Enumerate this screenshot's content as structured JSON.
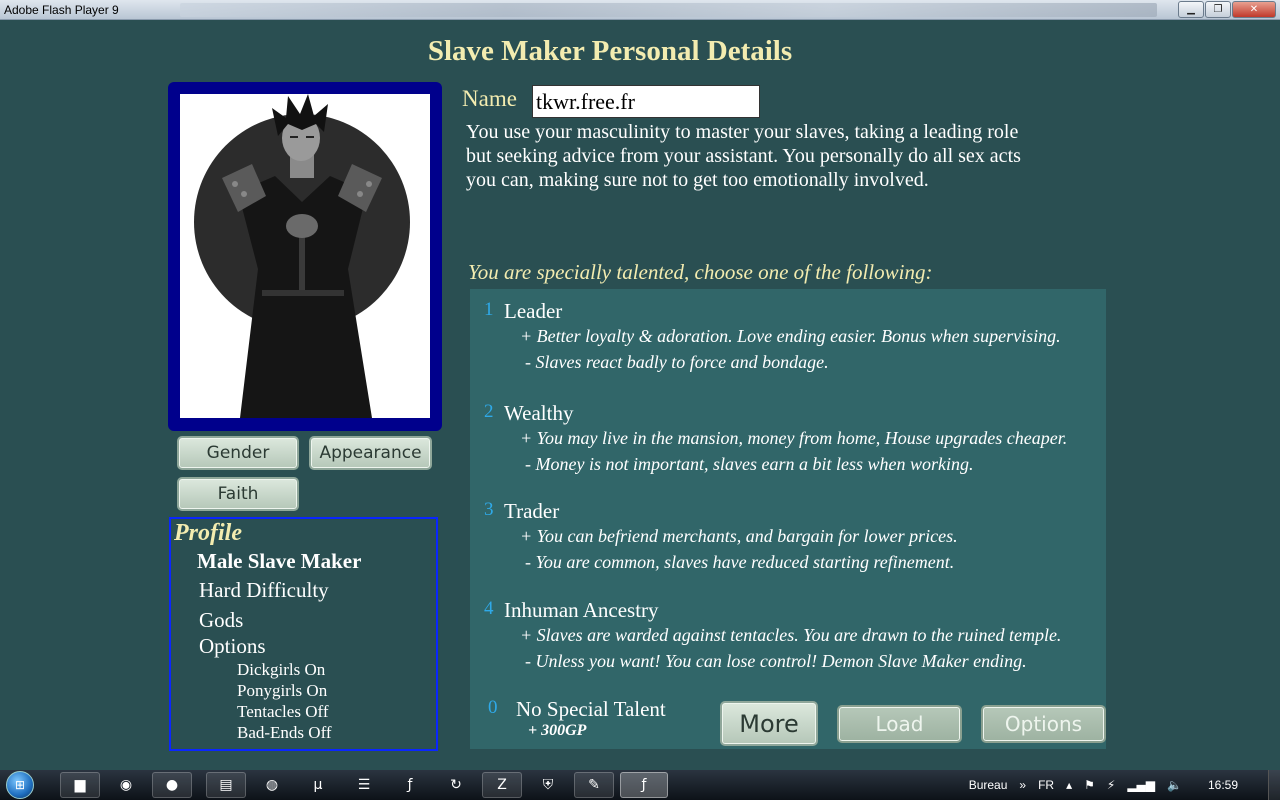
{
  "window": {
    "title": "Adobe Flash Player 9"
  },
  "header": {
    "title": "Slave Maker Personal Details"
  },
  "buttons": {
    "gender": "Gender",
    "appearance": "Appearance",
    "faith": "Faith",
    "more": "More",
    "load": "Load",
    "options": "Options"
  },
  "profile": {
    "title": "Profile",
    "type": "Male Slave Maker",
    "difficulty": "Hard Difficulty",
    "gods": "Gods",
    "options_label": "Options",
    "options": [
      "Dickgirls On",
      "Ponygirls On",
      "Tentacles Off",
      "Bad-Ends Off"
    ]
  },
  "name": {
    "label": "Name",
    "value": "tkwr.free.fr"
  },
  "description": [
    "You use your masculinity to master your slaves, taking a leading role",
    "but seeking advice from your assistant. You personally do all sex acts",
    "you can, making sure not to get too emotionally involved."
  ],
  "talents": {
    "prompt": "You are specially talented, choose one of the following:",
    "items": [
      {
        "num": "1",
        "name": "Leader",
        "plus": "+ Better loyalty & adoration. Love ending easier. Bonus when supervising.",
        "minus": "- Slaves react badly to force and bondage."
      },
      {
        "num": "2",
        "name": "Wealthy",
        "plus": "+ You may live in the mansion, money from home, House upgrades cheaper.",
        "minus": "- Money is not important, slaves earn a bit less when working."
      },
      {
        "num": "3",
        "name": "Trader",
        "plus": "+ You can befriend merchants, and bargain for lower prices.",
        "minus": "- You are common, slaves have reduced starting refinement."
      },
      {
        "num": "4",
        "name": "Inhuman Ancestry",
        "plus": "+ Slaves are warded against tentacles. You are drawn to the ruined temple.",
        "minus": "- Unless you want! You can lose control! Demon Slave Maker ending."
      }
    ],
    "none": {
      "num": "0",
      "name": "No Special Talent",
      "bonus": "+ 300GP"
    }
  },
  "taskbar": {
    "start_label": "⊞",
    "apps": [
      "explorer-icon",
      "avast-icon",
      "firefox-icon",
      "notepad-icon",
      "network-icon",
      "utorrent-icon",
      "file-manager-icon",
      "flash-icon",
      "refresh-icon",
      "filezilla-icon",
      "shield-icon",
      "paint-icon",
      "flash-player-icon"
    ],
    "tray": {
      "toolbar": "Bureau",
      "chevron": "»",
      "lang": "FR",
      "time": "16:59"
    }
  },
  "colors": {
    "background": "#2a4f52",
    "panel": "#316669",
    "title": "#f3ecb0",
    "accent_blue": "#2fa9e8",
    "frame": "#00008c",
    "profile_border": "#0a26ff"
  }
}
